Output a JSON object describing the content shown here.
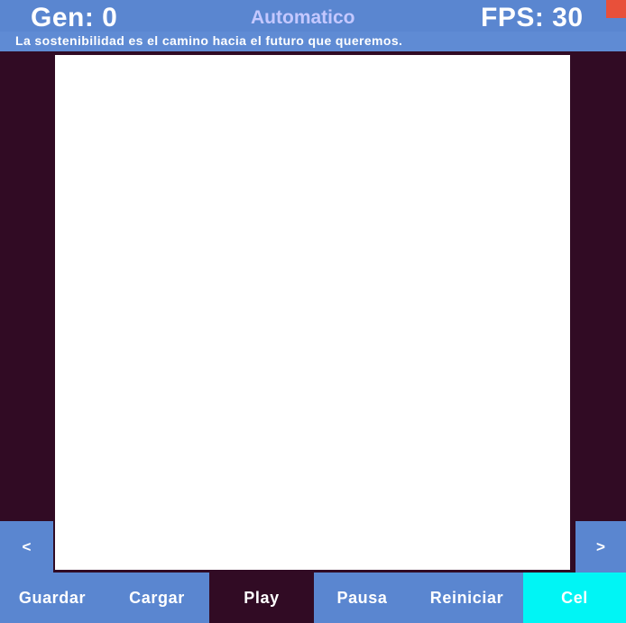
{
  "header": {
    "gen_label": "Gen: 0",
    "mode_label": "Automatico",
    "fps_label": "FPS: 30",
    "subtitle": "La sostenibilidad es el camino hacia el futuro que queremos."
  },
  "nav": {
    "prev_label": "<",
    "next_label": ">"
  },
  "toolbar": {
    "guardar_label": "Guardar",
    "cargar_label": "Cargar",
    "play_label": "Play",
    "pausa_label": "Pausa",
    "reiniciar_label": "Reiniciar",
    "cel_label": "Cel"
  },
  "colors": {
    "background": "#310b24",
    "panel": "#5a86d0",
    "canvas": "#ffffff",
    "close": "#e8503a",
    "cel_active": "#00f5f5",
    "mode_text": "#c4c8ff"
  }
}
